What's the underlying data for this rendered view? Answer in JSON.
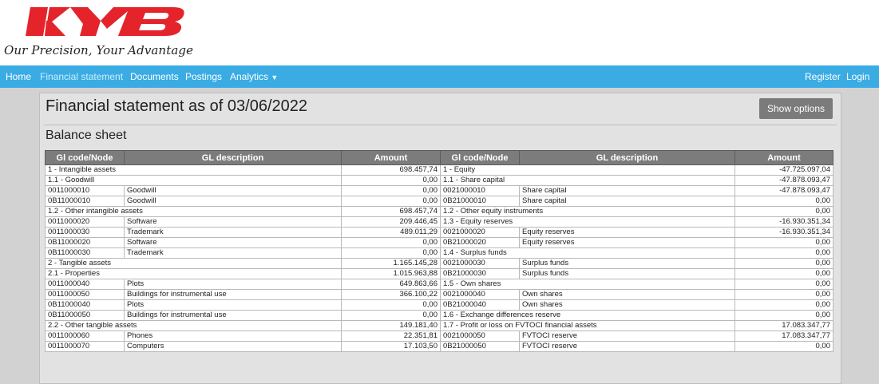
{
  "brand": {
    "logo_text": "KYB",
    "tagline": "Our Precision, Your Advantage",
    "accent_color": "#e4232b"
  },
  "nav": {
    "home": "Home",
    "financial_statement": "Financial statement",
    "documents": "Documents",
    "postings": "Postings",
    "analytics": "Analytics",
    "register": "Register",
    "login": "Login",
    "bar_color": "#3aace3"
  },
  "page": {
    "title": "Financial statement as of 03/06/2022",
    "show_options": "Show options",
    "section_title": "Balance sheet"
  },
  "table": {
    "headers": [
      "Gl code/Node",
      "GL description",
      "Amount",
      "Gl code/Node",
      "GL description",
      "Amount"
    ],
    "rows": [
      {
        "left": {
          "node": "1 - Intangible assets",
          "amount": "698.457,74"
        },
        "right": {
          "node": "1 - Equity",
          "amount": "-47.725.097,04"
        }
      },
      {
        "left": {
          "node": "1.1 - Goodwill",
          "amount": "0,00"
        },
        "right": {
          "node": "1.1 - Share capital",
          "amount": "-47.878.093,47"
        }
      },
      {
        "left": {
          "code": "0011000010",
          "desc": "Goodwill",
          "amount": "0,00"
        },
        "right": {
          "code": "0021000010",
          "desc": "Share capital",
          "amount": "-47.878.093,47"
        }
      },
      {
        "left": {
          "code": "0B11000010",
          "desc": "Goodwill",
          "amount": "0,00"
        },
        "right": {
          "code": "0B21000010",
          "desc": "Share capital",
          "amount": "0,00"
        }
      },
      {
        "left": {
          "node": "1.2 - Other intangible assets",
          "amount": "698.457,74"
        },
        "right": {
          "node": "1.2 - Other equity instruments",
          "amount": "0,00"
        }
      },
      {
        "left": {
          "code": "0011000020",
          "desc": "Software",
          "amount": "209.446,45"
        },
        "right": {
          "node": "1.3 - Equity reserves",
          "amount": "-16.930.351,34"
        }
      },
      {
        "left": {
          "code": "0011000030",
          "desc": "Trademark",
          "amount": "489.011,29"
        },
        "right": {
          "code": "0021000020",
          "desc": "Equity reserves",
          "amount": "-16.930.351,34"
        }
      },
      {
        "left": {
          "code": "0B11000020",
          "desc": "Software",
          "amount": "0,00"
        },
        "right": {
          "code": "0B21000020",
          "desc": "Equity reserves",
          "amount": "0,00"
        }
      },
      {
        "left": {
          "code": "0B11000030",
          "desc": "Trademark",
          "amount": "0,00"
        },
        "right": {
          "node": "1.4 - Surplus funds",
          "amount": "0,00"
        }
      },
      {
        "left": {
          "node": "2 - Tangible assets",
          "amount": "1.165.145,28"
        },
        "right": {
          "code": "0021000030",
          "desc": "Surplus funds",
          "amount": "0,00"
        }
      },
      {
        "left": {
          "node": "2.1 - Properties",
          "amount": "1.015.963,88"
        },
        "right": {
          "code": "0B21000030",
          "desc": "Surplus funds",
          "amount": "0,00"
        }
      },
      {
        "left": {
          "code": "0011000040",
          "desc": "Plots",
          "amount": "649.863,66"
        },
        "right": {
          "node": "1.5 - Own shares",
          "amount": "0,00"
        }
      },
      {
        "left": {
          "code": "0011000050",
          "desc": "Buildings for instrumental use",
          "amount": "366.100,22"
        },
        "right": {
          "code": "0021000040",
          "desc": "Own shares",
          "amount": "0,00"
        }
      },
      {
        "left": {
          "code": "0B11000040",
          "desc": "Plots",
          "amount": "0,00"
        },
        "right": {
          "code": "0B21000040",
          "desc": "Own shares",
          "amount": "0,00"
        }
      },
      {
        "left": {
          "code": "0B11000050",
          "desc": "Buildings for instrumental use",
          "amount": "0,00"
        },
        "right": {
          "node": "1.6 - Exchange differences reserve",
          "amount": "0,00"
        }
      },
      {
        "left": {
          "node": "2.2 - Other tangible assets",
          "amount": "149.181,40"
        },
        "right": {
          "node": "1.7 - Profit or loss on FVTOCI financial assets",
          "amount": "17.083.347,77"
        }
      },
      {
        "left": {
          "code": "0011000060",
          "desc": "Phones",
          "amount": "22.351,81"
        },
        "right": {
          "code": "0021000050",
          "desc": "FVTOCI reserve",
          "amount": "17.083.347,77"
        }
      },
      {
        "left": {
          "code": "0011000070",
          "desc": "Computers",
          "amount": "17.103,50"
        },
        "right": {
          "code": "0B21000050",
          "desc": "FVTOCI reserve",
          "amount": "0,00"
        }
      }
    ]
  }
}
